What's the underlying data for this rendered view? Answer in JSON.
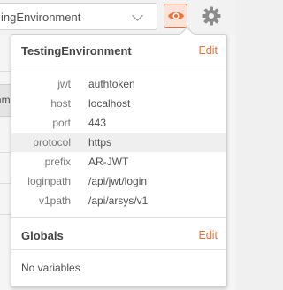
{
  "toolbar": {
    "environment_selected": "ingEnvironment",
    "chevron_icon": "chevron-down-icon",
    "eye_icon": "eye-icon",
    "gear_icon": "gear-icon",
    "accent_color": "#e8713e"
  },
  "background": {
    "left_tab_fragment": "am"
  },
  "popup": {
    "environment": {
      "title": "TestingEnvironment",
      "edit_label": "Edit",
      "variables": [
        {
          "key": "jwt",
          "value": "authtoken"
        },
        {
          "key": "host",
          "value": "localhost"
        },
        {
          "key": "port",
          "value": "443"
        },
        {
          "key": "protocol",
          "value": "https",
          "highlighted": true
        },
        {
          "key": "prefix",
          "value": "AR-JWT"
        },
        {
          "key": "loginpath",
          "value": "/api/jwt/login"
        },
        {
          "key": "v1path",
          "value": "/api/arsys/v1"
        }
      ]
    },
    "globals": {
      "title": "Globals",
      "edit_label": "Edit",
      "empty_text": "No variables"
    }
  }
}
